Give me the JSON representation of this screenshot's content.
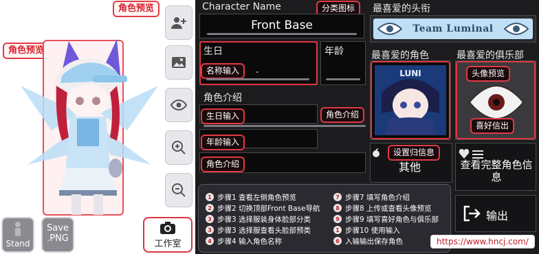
{
  "left": {
    "top_tag": "角色预览",
    "preview_tag": "角色预览",
    "stand_label": "Stand",
    "save_label": "Save\n.PNG",
    "studio_label": "工作室"
  },
  "panel": {
    "name_label": "Character Name",
    "name_tag": "分类图标",
    "name_value": "Front Base",
    "birthday_label": "生日",
    "age_label": "年龄",
    "birthday_value": ".",
    "name_input_tag": "名称输入",
    "intro_label": "角色介绍",
    "birthday_input_tag": "生日输入",
    "intro_tag": "角色介绍",
    "age_input_tag": "年龄输入",
    "intro_input_tag": "角色介绍",
    "fav_title_label": "最喜爱的头衔",
    "fav_title_value": "Team Luminal",
    "fav_char_label": "最喜爱的角色",
    "fav_club_label": "最喜爱的俱乐部",
    "avatar_tag": "头像预览",
    "hobby_tag": "喜好信出",
    "other_tag": "设置归信息",
    "other_label": "其他",
    "full_info_label": "查看完整角色信息",
    "exit_label": "输出",
    "watermark": "https://www.hncj.com/"
  },
  "steps": {
    "left": [
      {
        "n": "1",
        "text": "步骤1 查看左侧角色预览"
      },
      {
        "n": "2",
        "text": "步骤2 切换顶部Front Base导航"
      },
      {
        "n": "3",
        "text": "步骤3 选择服装身体脸部分类"
      },
      {
        "n": "3",
        "text": "步骤3 选择服查看头脸部预类"
      },
      {
        "n": "4",
        "text": "步骤4 输入角色名称"
      }
    ],
    "right": [
      {
        "n": "7",
        "text": "步骤7 填写角色介绍"
      },
      {
        "n": "8",
        "text": "步骤8 上传或查看头像预览"
      },
      {
        "n": "9",
        "text": "步骤9 填写喜好角色与俱乐部"
      },
      {
        "n": "1",
        "text": "步骤10 使用输入"
      },
      {
        "n": "6",
        "text": "入输输出保存角色"
      }
    ]
  },
  "colors": {
    "accent_red": "#e6353f",
    "panel_bg": "#1c1c1e"
  }
}
